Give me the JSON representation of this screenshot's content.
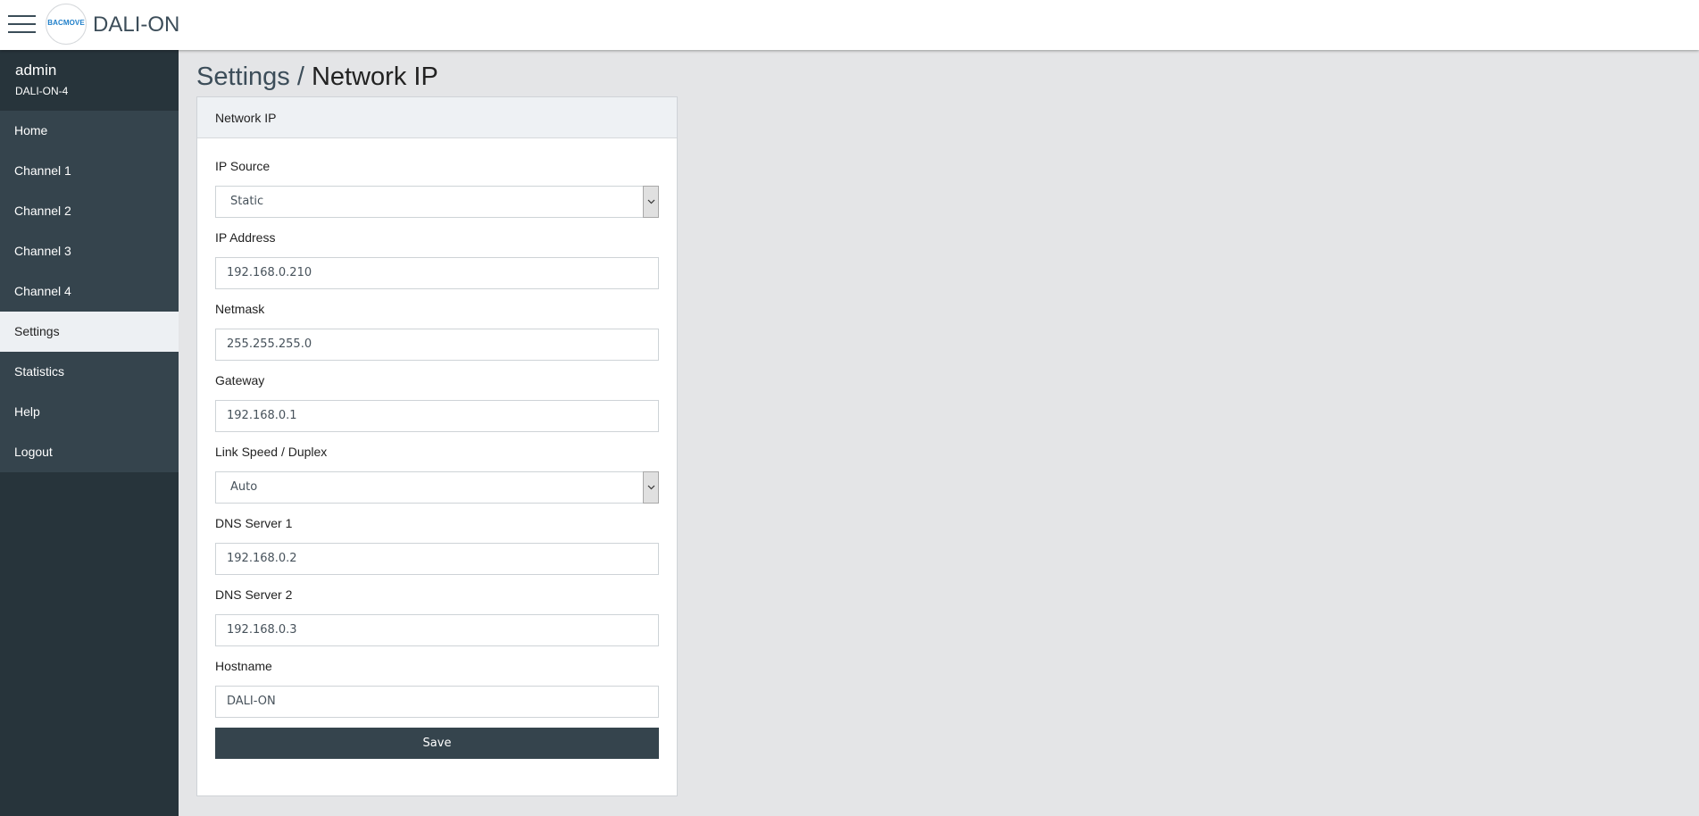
{
  "header": {
    "menu_icon": "hamburger-menu-icon",
    "logo_text": "BACMOVE",
    "app_title": "DALI-ON"
  },
  "user": {
    "name": "admin",
    "device": "DALI-ON-4"
  },
  "sidebar": {
    "items": [
      {
        "label": "Home"
      },
      {
        "label": "Channel 1"
      },
      {
        "label": "Channel 2"
      },
      {
        "label": "Channel 3"
      },
      {
        "label": "Channel 4"
      },
      {
        "label": "Settings",
        "active": true
      },
      {
        "label": "Statistics"
      },
      {
        "label": "Help"
      },
      {
        "label": "Logout"
      }
    ]
  },
  "page": {
    "breadcrumb_root": "Settings",
    "breadcrumb_sep": " / ",
    "breadcrumb_current": "Network IP"
  },
  "card": {
    "title": "Network IP",
    "fields": {
      "ip_source": {
        "label": "IP Source",
        "value": "Static"
      },
      "ip_address": {
        "label": "IP Address",
        "value": "192.168.0.210"
      },
      "netmask": {
        "label": "Netmask",
        "value": "255.255.255.0"
      },
      "gateway": {
        "label": "Gateway",
        "value": "192.168.0.1"
      },
      "link_speed": {
        "label": "Link Speed / Duplex",
        "value": "Auto"
      },
      "dns1": {
        "label": "DNS Server 1",
        "value": "192.168.0.2"
      },
      "dns2": {
        "label": "DNS Server 2",
        "value": "192.168.0.3"
      },
      "hostname": {
        "label": "Hostname",
        "value": "DALI-ON"
      }
    },
    "save_label": "Save"
  },
  "colors": {
    "sidebar_bg": "#27343b",
    "nav_bg": "#35444d",
    "active_bg": "#edf0f3",
    "button_bg": "#35444d",
    "page_bg": "#e4e5e7"
  }
}
